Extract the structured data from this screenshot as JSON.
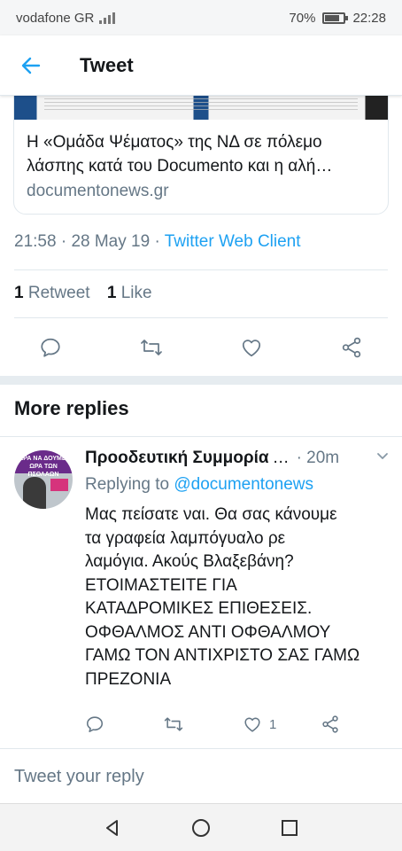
{
  "status_bar": {
    "carrier": "vodafone GR",
    "battery": "70%",
    "time": "22:28"
  },
  "app_bar": {
    "title": "Tweet"
  },
  "link_card": {
    "headline_line1": "Η «Ομάδα Ψέματος» της ΝΔ σε πόλεμο",
    "headline_line2": "λάσπης κατά του Documento και η αλή…",
    "domain": "documentonews.gr"
  },
  "tweet_meta": {
    "time": "21:58",
    "date": "28 May 19",
    "client": "Twitter Web Client"
  },
  "stats": {
    "retweets_count": "1",
    "retweets_label": "Retweet",
    "likes_count": "1",
    "likes_label": "Like"
  },
  "more_replies": {
    "heading": "More replies"
  },
  "reply": {
    "avatar_text": "ΤΩΡΑ ΝΑ ΔΟΥΜΕ Η ΩΡΑ ΤΩΝ ΠΣΟΛΑΩΝ",
    "name": "Προοδευτική Συμμορία",
    "dots": "…",
    "time": "· 20m",
    "replying_prefix": "Replying to",
    "replying_handle": "@documentonews",
    "body_lines": [
      "Μας πείσατε ναι. Θα σας κάνουμε",
      "τα γραφεία λαμπόγυαλο ρε",
      "λαμόγια. Ακούς Βλαξεβάνη?",
      "ΕΤΟΙΜΑΣΤΕΙΤΕ ΓΙΑ",
      "ΚΑΤΑΔΡΟΜΙΚΕΣ ΕΠΙΘΕΣΕΙΣ.",
      "ΟΦΘΑΛΜΟΣ ΑΝΤΙ ΟΦΘΑΛΜΟΥ",
      "ΓΑΜΩ ΤΟΝ ΑΝΤΙΧΡΙΣΤΟ ΣΑΣ ΓΑΜΩ",
      "ΠΡΕΖΟΝΙΑ"
    ],
    "like_count": "1"
  },
  "compose": {
    "placeholder": "Tweet your reply"
  },
  "colors": {
    "accent": "#1da1f2",
    "secondary_text": "#657786",
    "divider": "#e1e8ed"
  },
  "icons": {
    "back": "arrow-left-icon",
    "reply": "speech-bubble-icon",
    "retweet": "retweet-icon",
    "like": "heart-icon",
    "share": "share-icon",
    "chevron": "chevron-down-icon",
    "nav_back": "triangle-back-icon",
    "nav_home": "circle-home-icon",
    "nav_recents": "square-recents-icon"
  }
}
